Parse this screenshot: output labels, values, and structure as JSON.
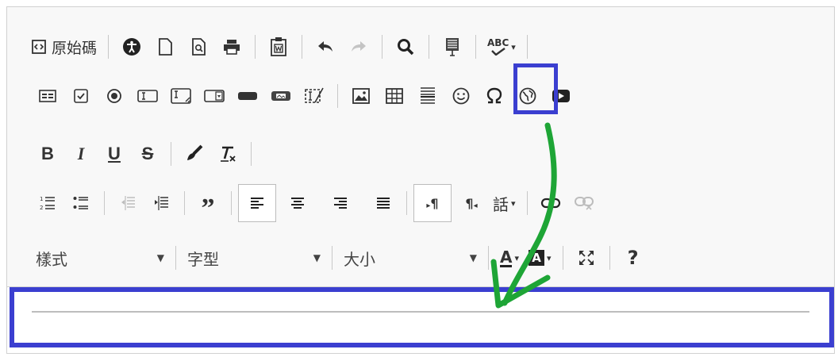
{
  "toolbar": {
    "source_label": "原始碼",
    "spell_label": "ABC",
    "chinese_label": "話",
    "style_label": "樣式",
    "font_label": "字型",
    "size_label": "大小",
    "help_label": "?"
  },
  "icons": {
    "row1": [
      "source-icon",
      "accessibility-icon",
      "new-page-icon",
      "preview-icon",
      "print-icon",
      "paste-word-icon",
      "undo-icon",
      "redo-icon",
      "search-icon",
      "select-all-icon",
      "spellcheck-icon"
    ],
    "row2": [
      "form-icon",
      "checkbox-icon",
      "radio-icon",
      "textfield-icon",
      "textarea-icon",
      "select-icon",
      "button-icon",
      "image-button-icon",
      "hidden-field-icon",
      "image-icon",
      "table-icon",
      "horizontal-line-icon",
      "smiley-icon",
      "special-char-icon",
      "iframe-icon",
      "youtube-icon"
    ],
    "row3": [
      "bold-icon",
      "italic-icon",
      "underline-icon",
      "strike-icon",
      "copy-format-icon",
      "remove-format-icon"
    ],
    "row4": [
      "numbered-list-icon",
      "bulleted-list-icon",
      "outdent-icon",
      "indent-icon",
      "blockquote-icon",
      "align-left-icon",
      "align-center-icon",
      "align-right-icon",
      "justify-icon",
      "ltr-icon",
      "rtl-icon",
      "language-icon",
      "link-icon",
      "unlink-icon"
    ],
    "row5": [
      "style-dropdown",
      "font-dropdown",
      "size-dropdown",
      "text-color-icon",
      "bg-color-icon",
      "maximize-icon",
      "help-icon"
    ]
  },
  "colors": {
    "highlight": "#3b3fd0",
    "arrow": "#1ea536",
    "toolbar_bg": "#f8f8f8"
  }
}
